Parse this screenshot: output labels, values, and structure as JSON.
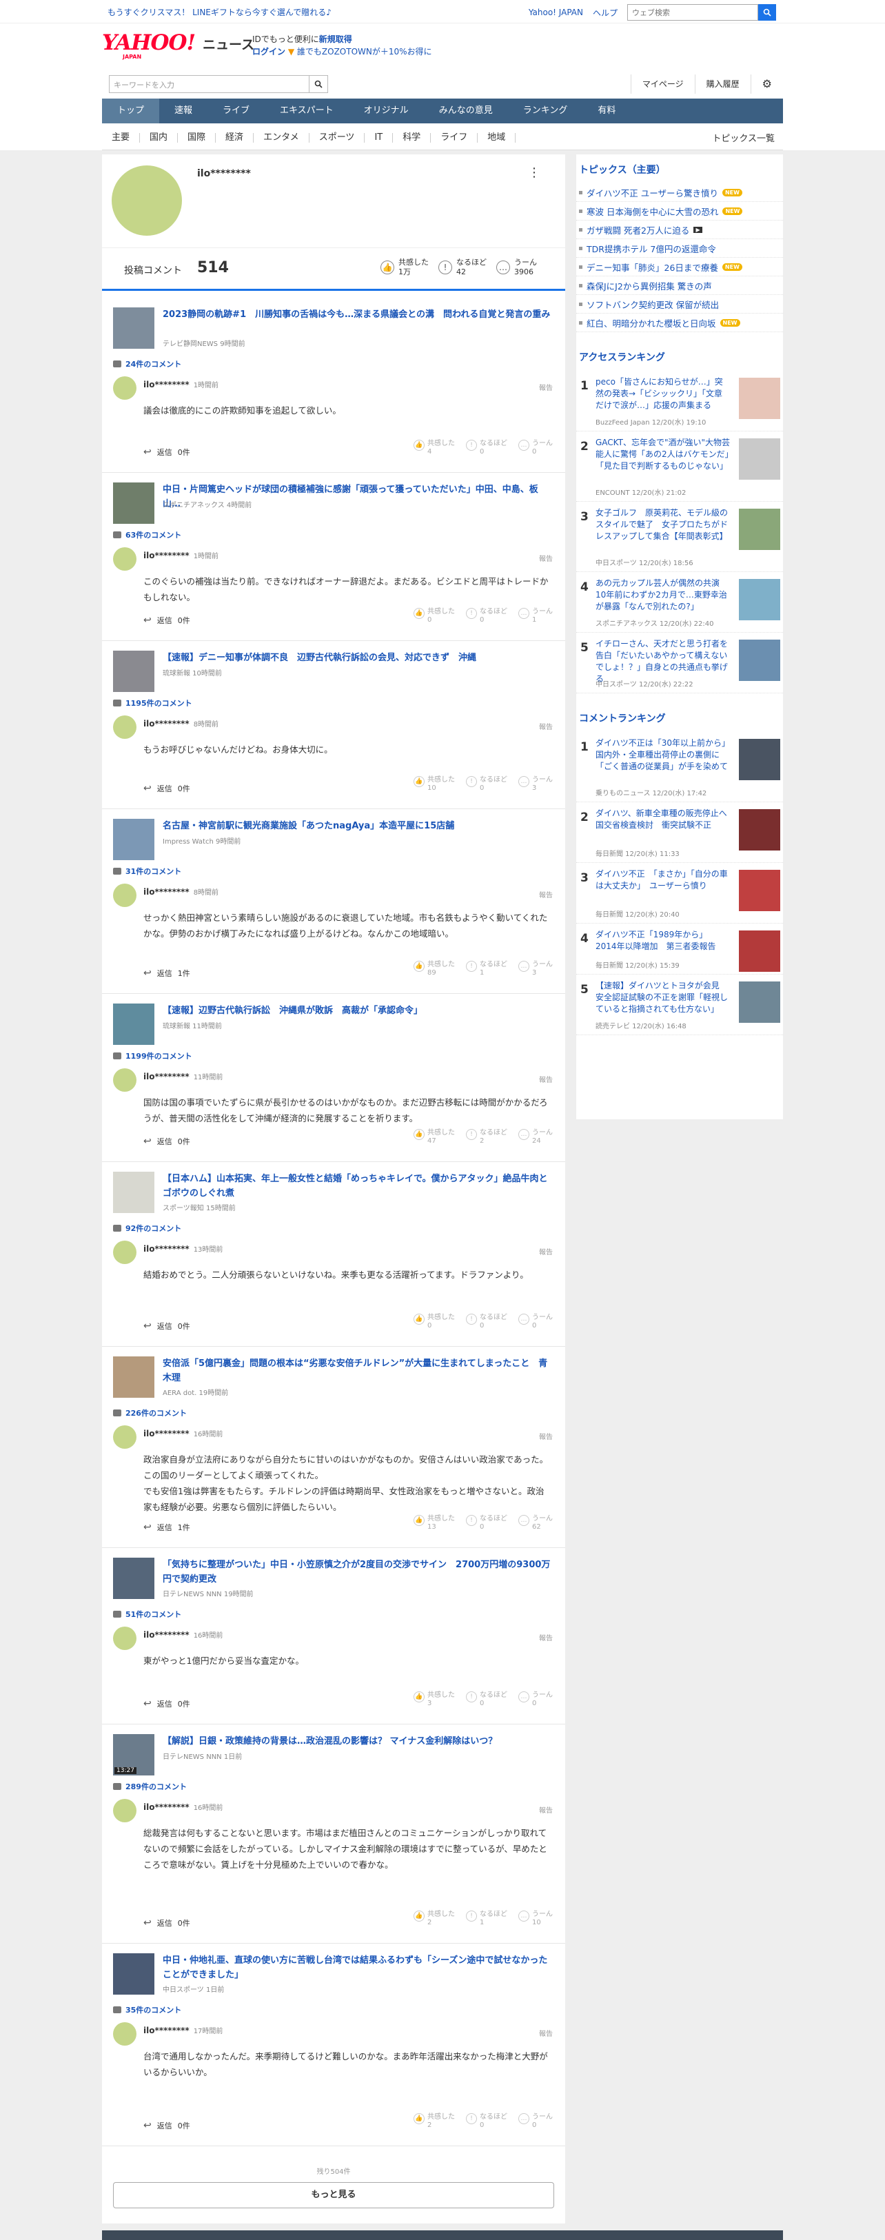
{
  "topbar": {
    "promo": "もうすぐクリスマス！ LINEギフトなら今すぐ選んで贈れる♪",
    "links": [
      "Yahoo! JAPAN",
      "ヘルプ"
    ],
    "search_placeholder": "ウェブ検索"
  },
  "brand": {
    "logo": "YAHOO!",
    "logo_sub": "JAPAN",
    "news": "ニュース",
    "line1_pre": "IDでもっと便利に",
    "line1_link": "新規取得",
    "line2_link": "ログイン",
    "line2_post": "誰でもZOZOTOWNが＋10%お得に"
  },
  "search": {
    "placeholder": "キーワードを入力",
    "links": [
      "マイページ",
      "購入履歴"
    ]
  },
  "global_nav": [
    "トップ",
    "速報",
    "ライブ",
    "エキスパート",
    "オリジナル",
    "みんなの意見",
    "ランキング",
    "有料"
  ],
  "sub_nav": [
    "主要",
    "国内",
    "国際",
    "経済",
    "エンタメ",
    "スポーツ",
    "IT",
    "科学",
    "ライフ",
    "地域"
  ],
  "sub_nav_all": "トピックス一覧",
  "profile": {
    "name": "ilo********",
    "comment_label": "投稿コメント",
    "comment_count": "514",
    "stats": [
      {
        "label": "共感した",
        "value": "1万",
        "icon": "thumbs-up-icon"
      },
      {
        "label": "なるほど",
        "value": "42",
        "icon": "lightbulb-icon"
      },
      {
        "label": "うーん",
        "value": "3906",
        "icon": "thinking-icon"
      }
    ]
  },
  "reaction_labels": [
    "共感した",
    "なるほど",
    "うーん"
  ],
  "report_label": "報告",
  "reply_prefix": "返信",
  "items": [
    {
      "title": "2023静岡の軌跡#1　川勝知事の舌禍は今も…深まる県議会との溝　問われる自覚と発言の重み",
      "source": "テレビ静岡NEWS 9時間前",
      "comments": "24件のコメント",
      "user": "ilo********",
      "time": "1時間前",
      "body": "議会は徹底的にこの許欺師知事を追起して欲しい。",
      "reply": "0件",
      "reactions": [
        "4",
        "0",
        "0"
      ]
    },
    {
      "title": "中日・片岡篤史ヘッドが球団の積極補強に感謝「頑張って獲っていただいた」中田、中島、板山…",
      "source": "スポニチアネックス 4時間前",
      "comments": "63件のコメント",
      "user": "ilo********",
      "time": "1時間前",
      "body": "このぐらいの補強は当たり前。できなければオーナー辞退だよ。まだある。ビシエドと周平はトレードかもしれない。",
      "reply": "0件",
      "reactions": [
        "0",
        "0",
        "1"
      ]
    },
    {
      "title": "【速報】デニー知事が体調不良　辺野古代執行訴訟の会見、対応できず　沖縄",
      "source": "琉球新報 10時間前",
      "comments": "1195件のコメント",
      "user": "ilo********",
      "time": "8時間前",
      "body": "もうお呼びじゃないんだけどね。お身体大切に。",
      "reply": "0件",
      "reactions": [
        "10",
        "0",
        "3"
      ]
    },
    {
      "title": "名古屋・神宮前駅に観光商業施設「あつたnagAya」本造平屋に15店舗",
      "source": "Impress Watch 9時間前",
      "comments": "31件のコメント",
      "user": "ilo********",
      "time": "8時間前",
      "body": "せっかく熱田神宮という素晴らしい施設があるのに衰退していた地域。市も名鉄もようやく動いてくれたかな。伊勢のおかげ横丁みたになれば盛り上がるけどね。なんかこの地域暗い。",
      "reply": "1件",
      "reactions": [
        "89",
        "1",
        "3"
      ]
    },
    {
      "title": "【速報】辺野古代執行訴訟　沖縄県が敗訴　高裁が「承認命令」",
      "source": "琉球新報 11時間前",
      "comments": "1199件のコメント",
      "user": "ilo********",
      "time": "11時間前",
      "body": "国防は国の事項でいたずらに県が長引かせるのはいかがなものか。まだ辺野古移転には時間がかかるだろうが、普天間の活性化をして沖縄が経済的に発展することを祈ります。",
      "reply": "0件",
      "reactions": [
        "47",
        "2",
        "24"
      ]
    },
    {
      "title": "【日本ハム】山本拓実、年上一般女性と結婚「めっちゃキレイで。僕からアタック」絶品牛肉とゴボウのしぐれ煮",
      "source": "スポーツ報知 15時間前",
      "comments": "92件のコメント",
      "user": "ilo********",
      "time": "13時間前",
      "body": "結婚おめでとう。二人分頑張らないといけないね。来季も更なる活躍祈ってます。ドラファンより。",
      "reply": "0件",
      "reactions": [
        "0",
        "0",
        "0"
      ]
    },
    {
      "title": "安倍派「5億円裏金」問題の根本は“劣悪な安倍チルドレン”が大量に生まれてしまったこと　青木理",
      "source": "AERA dot. 19時間前",
      "comments": "226件のコメント",
      "user": "ilo********",
      "time": "16時間前",
      "body": "政治家自身が立法府にありながら自分たちに甘いのはいかがなものか。安倍さんはいい政治家であった。この国のリーダーとしてよく頑張ってくれた。\nでも安倍1強は弊害をもたらす。チルドレンの評価は時期尚早、女性政治家をもっと増やさないと。政治家も経験が必要。劣悪なら個別に評価したらいい。",
      "reply": "1件",
      "reactions": [
        "13",
        "0",
        "62"
      ]
    },
    {
      "title": "「気持ちに整理がついた」中日・小笠原慎之介が2度目の交渉でサイン　2700万円増の9300万円で契約更改",
      "source": "日テレNEWS NNN 19時間前",
      "comments": "51件のコメント",
      "user": "ilo********",
      "time": "16時間前",
      "body": "東がやっと1億円だから妥当な査定かな。",
      "reply": "0件",
      "reactions": [
        "3",
        "0",
        "0"
      ]
    },
    {
      "title": "【解説】日銀・政策維持の背景は…政治混乱の影響は？ マイナス金利解除はいつ？",
      "source": "日テレNEWS NNN 1日前",
      "comments": "289件のコメント",
      "user": "ilo********",
      "time": "16時間前",
      "body": "総裁発言は何もすることないと思います。市場はまだ植田さんとのコミュニケーションがしっかり取れてないので頻繁に会話をしたがっている。しかしマイナス金利解除の環境はすでに整っているが、早めたところで意味がない。賃上げを十分見極めた上でいいので春かな。",
      "reply": "0件",
      "reactions": [
        "2",
        "1",
        "10"
      ],
      "video": "13:27"
    },
    {
      "title": "中日・仲地礼亜、直球の使い方に苦戦し台湾では結果ふるわずも「シーズン途中で試せなかったことができました」",
      "source": "中日スポーツ 1日前",
      "comments": "35件のコメント",
      "user": "ilo********",
      "time": "17時間前",
      "body": "台湾で通用しなかったんだ。来季期待してるけど難しいのかな。まあ昨年活躍出来なかった梅津と大野がいるからいいか。",
      "reply": "0件",
      "reactions": [
        "2",
        "0",
        "0"
      ]
    }
  ],
  "more": {
    "remaining": "残り504件",
    "button": "もっと見る"
  },
  "side": {
    "topics_title": "トピックス（主要）",
    "topics": [
      {
        "t": "ダイハツ不正 ユーザーら驚き憤り",
        "tag": "NEW"
      },
      {
        "t": "寒波 日本海側を中心に大雪の恐れ",
        "tag": "NEW"
      },
      {
        "t": "ガザ戦闘 死者2万人に迫る",
        "tag": "VIDEO"
      },
      {
        "t": "TDR提携ホテル 7億円の返還命令",
        "tag": ""
      },
      {
        "t": "デニー知事「肺炎」26日まで療養",
        "tag": "NEW"
      },
      {
        "t": "森保JにJ2から異例招集 驚きの声",
        "tag": ""
      },
      {
        "t": "ソフトバンク契約更改 保留が続出",
        "tag": ""
      },
      {
        "t": "紅白、明暗分かれた櫻坂と日向坂",
        "tag": "NEW"
      }
    ],
    "access_title": "アクセスランキング",
    "access": [
      {
        "n": "1",
        "t": "peco「皆さんにお知らせが…」突然の発表→「ビシッックリ」「文章だけで涙が…」応援の声集まる",
        "s": "BuzzFeed Japan 12/20(水) 19:10"
      },
      {
        "n": "2",
        "t": "GACKT、忘年会で\"酒が強い\"大物芸能人に驚愕「あの2人はバケモンだ」「見た目で判断するものじゃない」",
        "s": "ENCOUNT 12/20(水) 21:02"
      },
      {
        "n": "3",
        "t": "女子ゴルフ　原英莉花、モデル級のスタイルで魅了　女子プロたちがドレスアップして集合【年間表彰式】",
        "s": "中日スポーツ 12/20(水) 18:56"
      },
      {
        "n": "4",
        "t": "あの元カップル芸人が偶然の共演　10年前にわずか2カ月で…東野幸治が暴露「なんで別れたの?」",
        "s": "スポニチアネックス 12/20(水) 22:40"
      },
      {
        "n": "5",
        "t": "イチローさん、天才だと思う打者を告白「だいたいあやかって構えないでしょ！？」自身との共通点も挙げる",
        "s": "中日スポーツ 12/20(水) 22:22"
      }
    ],
    "comment_title": "コメントランキング",
    "comment_rank": [
      {
        "n": "1",
        "t": "ダイハツ不正は「30年以上前から」国内外・全車種出荷停止の裏側に「ごく普通の従業員」が手を染めて",
        "s": "乗りものニュース 12/20(水) 17:42"
      },
      {
        "n": "2",
        "t": "ダイハツ、新車全車種の販売停止へ　国交省検査検討　衝突試験不正",
        "s": "毎日新聞 12/20(水) 11:33"
      },
      {
        "n": "3",
        "t": "ダイハツ不正　「まさか」「自分の車は大丈夫か」　ユーザーら憤り",
        "s": "毎日新聞 12/20(水) 20:40"
      },
      {
        "n": "4",
        "t": "ダイハツ不正「1989年から」　2014年以降増加　第三者委報告",
        "s": "毎日新聞 12/20(水) 15:39"
      },
      {
        "n": "5",
        "t": "【速報】ダイハツとトヨタが会見　安全認証試験の不正を謝罪「軽視していると指摘されても仕方ない」",
        "s": "読売テレビ 12/20(水) 16:48"
      }
    ]
  }
}
